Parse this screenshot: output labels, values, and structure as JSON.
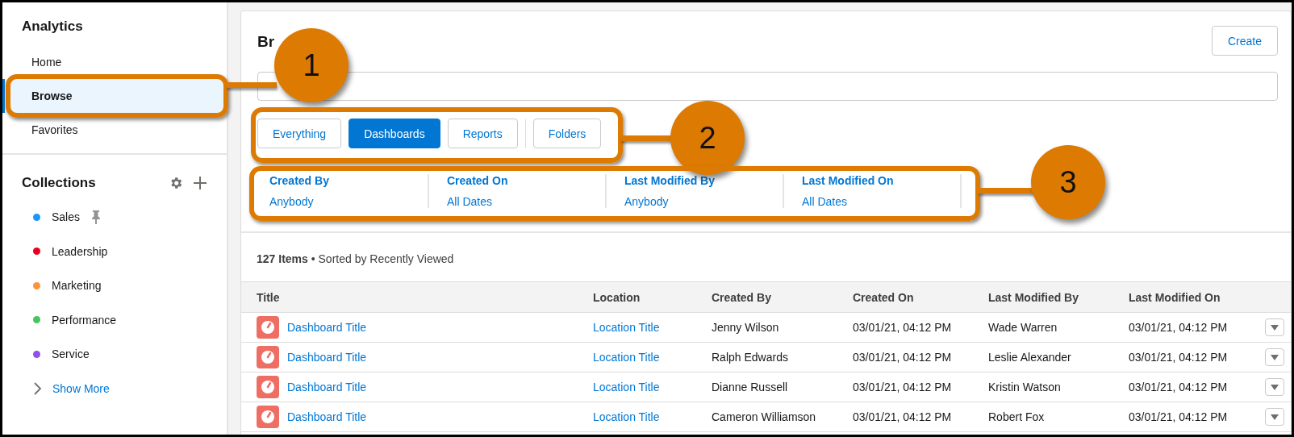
{
  "sidebar": {
    "title": "Analytics",
    "nav": [
      {
        "label": "Home",
        "selected": false
      },
      {
        "label": "Browse",
        "selected": true
      },
      {
        "label": "Favorites",
        "selected": false
      }
    ],
    "collections_title": "Collections",
    "collections": [
      {
        "label": "Sales",
        "color": "#1b96ff",
        "pinned": true
      },
      {
        "label": "Leadership",
        "color": "#ea001e",
        "pinned": false
      },
      {
        "label": "Marketing",
        "color": "#fe9339",
        "pinned": false
      },
      {
        "label": "Performance",
        "color": "#45c65a",
        "pinned": false
      },
      {
        "label": "Service",
        "color": "#9050e9",
        "pinned": false
      }
    ],
    "show_more": "Show More"
  },
  "main": {
    "title": "Br",
    "create_button": "Create",
    "tabs": [
      {
        "label": "Everything",
        "selected": false
      },
      {
        "label": "Dashboards",
        "selected": true
      },
      {
        "label": "Reports",
        "selected": false
      },
      {
        "label": "Folders",
        "selected": false
      }
    ],
    "filters": [
      {
        "label": "Created By",
        "value": "Anybody"
      },
      {
        "label": "Created On",
        "value": "All Dates"
      },
      {
        "label": "Last Modified By",
        "value": "Anybody"
      },
      {
        "label": "Last Modified On",
        "value": "All Dates"
      }
    ],
    "summary": "**127 Items** • Sorted by Recently Viewed",
    "table": {
      "columns": [
        "Title",
        "Location",
        "Created By",
        "Created On",
        "Last Modified By",
        "Last Modified On"
      ],
      "rows": [
        {
          "title": "Dashboard Title",
          "location": "Location Title",
          "created_by": "Jenny Wilson",
          "created_on": "03/01/21, 04:12 PM",
          "modified_by": "Wade Warren",
          "modified_on": "03/01/21, 04:12 PM"
        },
        {
          "title": "Dashboard Title",
          "location": "Location Title",
          "created_by": "Ralph Edwards",
          "created_on": "03/01/21, 04:12 PM",
          "modified_by": "Leslie Alexander",
          "modified_on": "03/01/21, 04:12 PM"
        },
        {
          "title": "Dashboard Title",
          "location": "Location Title",
          "created_by": "Dianne Russell",
          "created_on": "03/01/21, 04:12 PM",
          "modified_by": "Kristin Watson",
          "modified_on": "03/01/21, 04:12 PM"
        },
        {
          "title": "Dashboard Title",
          "location": "Location Title",
          "created_by": "Cameron Williamson",
          "created_on": "03/01/21, 04:12 PM",
          "modified_by": "Robert Fox",
          "modified_on": "03/01/21, 04:12 PM"
        }
      ]
    }
  },
  "callouts": [
    {
      "number": "1"
    },
    {
      "number": "2"
    },
    {
      "number": "3"
    }
  ]
}
